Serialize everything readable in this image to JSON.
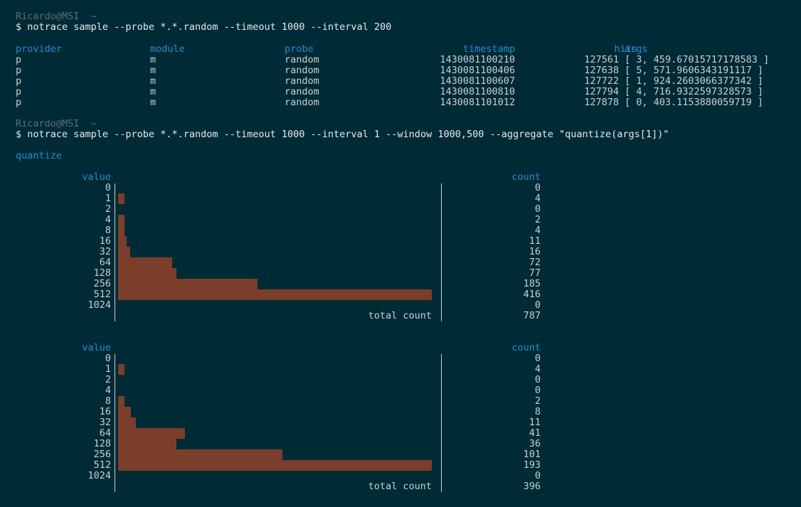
{
  "prompt1": {
    "user": "Ricardo@MSI",
    "cwd": "~"
  },
  "command1": "$ notrace sample --probe *.*.random --timeout 1000 --interval 200",
  "table": {
    "headers": [
      "provider",
      "module",
      "probe",
      "timestamp",
      "hits",
      "args"
    ],
    "rows": [
      [
        "p",
        "m",
        "random",
        "1430081100210",
        "127561",
        "[ 3, 459.67015717178583 ]"
      ],
      [
        "p",
        "m",
        "random",
        "1430081100406",
        "127638",
        "[ 5, 571.9606343191117 ]"
      ],
      [
        "p",
        "m",
        "random",
        "1430081100607",
        "127722",
        "[ 1, 924.2603066377342 ]"
      ],
      [
        "p",
        "m",
        "random",
        "1430081100810",
        "127794",
        "[ 4, 716.9322597328573 ]"
      ],
      [
        "p",
        "m",
        "random",
        "1430081101012",
        "127878",
        "[ 0, 403.1153880059719 ]"
      ]
    ]
  },
  "prompt2": {
    "user": "Ricardo@MSI",
    "cwd": "~"
  },
  "command2": "$ notrace sample --probe *.*.random --timeout 1000 --interval 1 --window 1000,500 --aggregate \"quantize(args[1])\"",
  "aggregate_title": "quantize",
  "histograms": [
    {
      "value_header": "value",
      "count_header": "count",
      "total_label": "total count",
      "total": "787",
      "buckets": [
        {
          "value": "0",
          "count": 0
        },
        {
          "value": "1",
          "count": 4
        },
        {
          "value": "2",
          "count": 0
        },
        {
          "value": "4",
          "count": 2
        },
        {
          "value": "8",
          "count": 4
        },
        {
          "value": "16",
          "count": 11
        },
        {
          "value": "32",
          "count": 16
        },
        {
          "value": "64",
          "count": 72
        },
        {
          "value": "128",
          "count": 77
        },
        {
          "value": "256",
          "count": 185
        },
        {
          "value": "512",
          "count": 416
        },
        {
          "value": "1024",
          "count": 0
        }
      ]
    },
    {
      "value_header": "value",
      "count_header": "count",
      "total_label": "total count",
      "total": "396",
      "buckets": [
        {
          "value": "0",
          "count": 0
        },
        {
          "value": "1",
          "count": 4
        },
        {
          "value": "2",
          "count": 0
        },
        {
          "value": "4",
          "count": 0
        },
        {
          "value": "8",
          "count": 2
        },
        {
          "value": "16",
          "count": 8
        },
        {
          "value": "32",
          "count": 11
        },
        {
          "value": "64",
          "count": 41
        },
        {
          "value": "128",
          "count": 36
        },
        {
          "value": "256",
          "count": 101
        },
        {
          "value": "512",
          "count": 193
        },
        {
          "value": "1024",
          "count": 0
        }
      ]
    }
  ],
  "colors": {
    "background": "#002b36",
    "text": "#c8cfcf",
    "dim": "#586e75",
    "accent": "#268bd2",
    "bar": "#7a3e2a"
  }
}
